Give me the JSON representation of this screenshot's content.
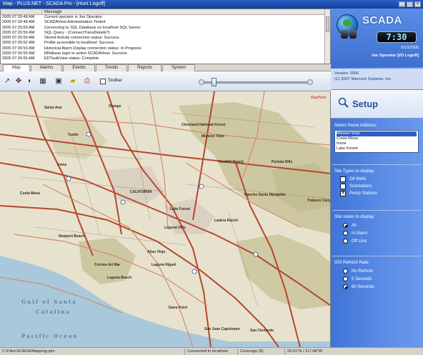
{
  "window": {
    "title": "Map - PLUS.NET - SCADA Pro - [Hunt Logoff]"
  },
  "log": {
    "col_time": "",
    "col_message": "Message",
    "rows": [
      {
        "time": "2005 07:20:48 AM",
        "message": "Current operator is Joe Operator"
      },
      {
        "time": "2005 07:20:48 AM",
        "message": "SCADAView Administration Tested"
      },
      {
        "time": "2005 07:20:59 AM",
        "message": "Connecting to SQL Database on localhost SQL Server"
      },
      {
        "time": "2005 07:20:59 AM",
        "message": "SQL Query - (ConnectTransDetails?)"
      },
      {
        "time": "2005 07:20:59 AM",
        "message": "Stored Activity connection status: Success"
      },
      {
        "time": "2005 07:26:52 AM",
        "message": "Profile accessible to localhost: Success"
      },
      {
        "time": "2005 07:26:53 AM",
        "message": "Historical Alarm Display connection status: In Progress"
      },
      {
        "time": "2005 07:26:55 AM",
        "message": "RRdbase login to active SCADAView: Success"
      },
      {
        "time": "2005 07:26:55 AM",
        "message": "EDTsutkView status: Complete"
      }
    ]
  },
  "tabs": [
    "Map",
    "Alarms",
    "Events",
    "Trends",
    "Reports",
    "System"
  ],
  "toolbar": {
    "checkbox_label": "Toolbar"
  },
  "map": {
    "brand": "MapPoint",
    "labels": [
      "Santa Ana",
      "Irvine",
      "Tustin",
      "Orange",
      "Costa Mesa",
      "Newport Beach",
      "Laguna Beach",
      "Mission Viejo",
      "Lake Forest",
      "Laguna Hills",
      "Aliso Viejo",
      "Laguna Niguel",
      "Dana Point",
      "San Juan Capistrano",
      "San Clemente",
      "Rancho Santa Margarita",
      "Ladera Ranch",
      "Foothill Ranch",
      "Portola Hills",
      "Trabuco Canyon",
      "CALIFORNIA",
      "Cleveland National Forest",
      "Corona del Mar"
    ],
    "ocean_labels": [
      "Gulf of Santa",
      "Catalina",
      "Pacific Ocean"
    ]
  },
  "status": {
    "file": "C:\\Files\\SCADA\\Mapping.ptm",
    "conn": "Connected to localhost",
    "ratio": "Coverage (8)",
    "coords": "33.61°N / 117.68°W"
  },
  "rpanel": {
    "brand": "SCADA",
    "clock": "7:30",
    "date": "5/13/2005",
    "user": "Joe Operator [I/O Logoff]",
    "version_line1": "Version: 2006",
    "version_line2": "(C) 2007 Warnock Systems, Inc.",
    "setup_label": "Setup",
    "select_home": {
      "title": "Select Home Address:",
      "items": [
        "Mission Viejo",
        "Costa Mesa",
        "Irvine",
        "Lake Forest"
      ],
      "selected_index": 0
    },
    "site_types": {
      "title": "Site Types to display:",
      "items": [
        {
          "label": "Oil Wells",
          "checked": false
        },
        {
          "label": "Substations",
          "checked": false
        },
        {
          "label": "Pump Stations",
          "checked": true
        }
      ]
    },
    "site_states": {
      "title": "Site states to display:",
      "items": [
        {
          "label": "All",
          "checked": true
        },
        {
          "label": "In Alarm",
          "checked": false
        },
        {
          "label": "Off Line",
          "checked": false
        }
      ]
    },
    "refresh": {
      "title": "GIS Refresh Rate:",
      "items": [
        {
          "label": "No Refresh",
          "checked": false
        },
        {
          "label": "5 Seconds",
          "checked": false
        },
        {
          "label": "60 Seconds",
          "checked": true
        }
      ]
    }
  },
  "colors": {
    "panel_blue": "#4f82df",
    "map_land": "#e7e2cd",
    "map_park": "#c9c39a",
    "road_major": "#b5472f",
    "water": "#a9c8dc"
  }
}
